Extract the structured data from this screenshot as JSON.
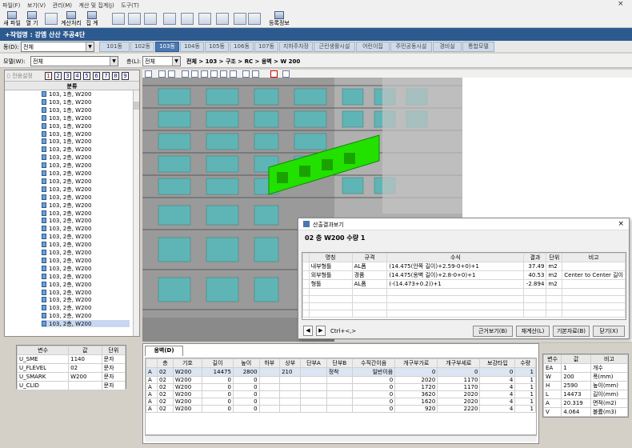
{
  "menu": [
    "파일(F)",
    "보기(V)",
    "관리(M)",
    "계산 및 집계(J)",
    "도구(T)"
  ],
  "toolbar": {
    "new_file": "새 파일",
    "open": "열 기",
    "calc": "계산처리",
    "total": "집 계",
    "register": "등록정보"
  },
  "window_close_icon": "close-icon",
  "work_title": "+작업명 : 강엠 산산 주공4단",
  "dong_label": "동(D):",
  "dong_value": "전체",
  "model_label": "모델(W):",
  "model_value": "전체",
  "floor_label": "층(L):",
  "floor_value": "전체",
  "breadcrumb": "전체 > 103 > 구조 > RC > 옹벽 > W 200",
  "tabs": [
    {
      "label": "101동",
      "active": false
    },
    {
      "label": "102동",
      "active": false
    },
    {
      "label": "103동",
      "active": true
    },
    {
      "label": "104동",
      "active": false
    },
    {
      "label": "105동",
      "active": false
    },
    {
      "label": "106동",
      "active": false
    },
    {
      "label": "107동",
      "active": false
    },
    {
      "label": "지하주차장",
      "active": false
    },
    {
      "label": "근린생활시설",
      "active": false
    },
    {
      "label": "어린이집",
      "active": false
    },
    {
      "label": "주민공동시설",
      "active": false
    },
    {
      "label": "경비실",
      "active": false
    },
    {
      "label": "통합모델",
      "active": false
    }
  ],
  "left_toolbar": {
    "filter_label": "전용설정",
    "numbers": [
      "1",
      "2",
      "3",
      "4",
      "5",
      "6",
      "7",
      "8",
      "9"
    ]
  },
  "tree": {
    "header": "분류",
    "items": [
      {
        "label": "103, 1층, W200"
      },
      {
        "label": "103, 1층, W200"
      },
      {
        "label": "103, 1층, W200"
      },
      {
        "label": "103, 1층, W200"
      },
      {
        "label": "103, 1층, W200"
      },
      {
        "label": "103, 1층, W200"
      },
      {
        "label": "103, 1층, W200"
      },
      {
        "label": "103, 2층, W200"
      },
      {
        "label": "103, 2층, W200"
      },
      {
        "label": "103, 2층, W200"
      },
      {
        "label": "103, 2층, W200"
      },
      {
        "label": "103, 2층, W200"
      },
      {
        "label": "103, 2층, W200"
      },
      {
        "label": "103, 2층, W200"
      },
      {
        "label": "103, 2층, W200"
      },
      {
        "label": "103, 2층, W200"
      },
      {
        "label": "103, 2층, W200"
      },
      {
        "label": "103, 2층, W200"
      },
      {
        "label": "103, 2층, W200"
      },
      {
        "label": "103, 2층, W200"
      },
      {
        "label": "103, 2층, W200"
      },
      {
        "label": "103, 2층, W200"
      },
      {
        "label": "103, 2층, W200"
      },
      {
        "label": "103, 2층, W200"
      },
      {
        "label": "103, 2층, W200"
      },
      {
        "label": "103, 2층, W200"
      },
      {
        "label": "103, 2층, W200"
      },
      {
        "label": "103, 2층, W200"
      },
      {
        "label": "103, 2층, W200"
      },
      {
        "label": "103, 2층, W200"
      }
    ]
  },
  "var_table": {
    "headers": [
      "변수",
      "값",
      "단위"
    ],
    "rows": [
      [
        "U_SME",
        "1140",
        "문자"
      ],
      [
        "U_FLEVEL",
        "02",
        "문자"
      ],
      [
        "U_SMARK",
        "W200",
        "문자"
      ],
      [
        "U_CLID",
        "",
        "문자"
      ]
    ]
  },
  "dialog": {
    "title": "산출결과보기",
    "subtitle": "02 층 W200 수량 1",
    "headers": [
      "명칭",
      "규격",
      "수식",
      "결과",
      "단위",
      "비고"
    ],
    "rows": [
      [
        "내부형틀",
        "AL폼",
        "(14.475(안쪽 길이)+2.59-0+0)+1",
        "37.49",
        "m2",
        ""
      ],
      [
        "외부형틀",
        "경품",
        "(14.475(옹벽 길이)+2.8-0+0)+1",
        "40.53",
        "m2",
        "Center to Center 길이"
      ],
      [
        "형틀",
        "AL폼",
        "(-(14.473+0.2))+1",
        "-2.894",
        "m2",
        ""
      ]
    ],
    "hint": "Ctrl+<,>",
    "buttons": [
      "근거보기(B)",
      "재계산(L)",
      "기본자료(B)",
      "닫기(X)"
    ]
  },
  "bottom": {
    "tab": "옹벽(D)",
    "headers": [
      "",
      "층",
      "기호",
      "길이",
      "높이",
      "하부",
      "상부",
      "단부A",
      "단부B",
      "수직간이음",
      "개구부가로",
      "개구부세로",
      "보강타입",
      "수량"
    ],
    "rows": [
      [
        "A",
        "02",
        "W200",
        "14475",
        "2800",
        "",
        "210",
        "",
        "정착",
        "일반이음",
        "0",
        "0",
        "0",
        "1"
      ],
      [
        "A",
        "02",
        "W200",
        "0",
        "0",
        "",
        "",
        "",
        "",
        "0",
        "2020",
        "1170",
        "4",
        "1"
      ],
      [
        "A",
        "02",
        "W200",
        "0",
        "0",
        "",
        "",
        "",
        "",
        "0",
        "1720",
        "1170",
        "4",
        "1"
      ],
      [
        "A",
        "02",
        "W200",
        "0",
        "0",
        "",
        "",
        "",
        "",
        "0",
        "3620",
        "2020",
        "4",
        "1"
      ],
      [
        "A",
        "02",
        "W200",
        "0",
        "0",
        "",
        "",
        "",
        "",
        "0",
        "1620",
        "2020",
        "4",
        "1"
      ],
      [
        "A",
        "02",
        "W200",
        "0",
        "0",
        "",
        "",
        "",
        "",
        "0",
        "920",
        "2220",
        "4",
        "1"
      ]
    ]
  },
  "right_table": {
    "headers": [
      "변수",
      "값",
      "비고"
    ],
    "rows": [
      [
        "EA",
        "1",
        "개수"
      ],
      [
        "W",
        "200",
        "폭(mm)"
      ],
      [
        "H",
        "2590",
        "높이(mm)"
      ],
      [
        "L",
        "14473",
        "길이(mm)"
      ],
      [
        "A",
        "20.319",
        "면적(m2)"
      ],
      [
        "V",
        "4.064",
        "볼륨(m3)"
      ]
    ]
  },
  "colors": {
    "title_bar": "#2d5a8e",
    "tab_active": "#4a78b0",
    "wall_green": "#22e000",
    "building_teal": "#5fb5b5"
  }
}
